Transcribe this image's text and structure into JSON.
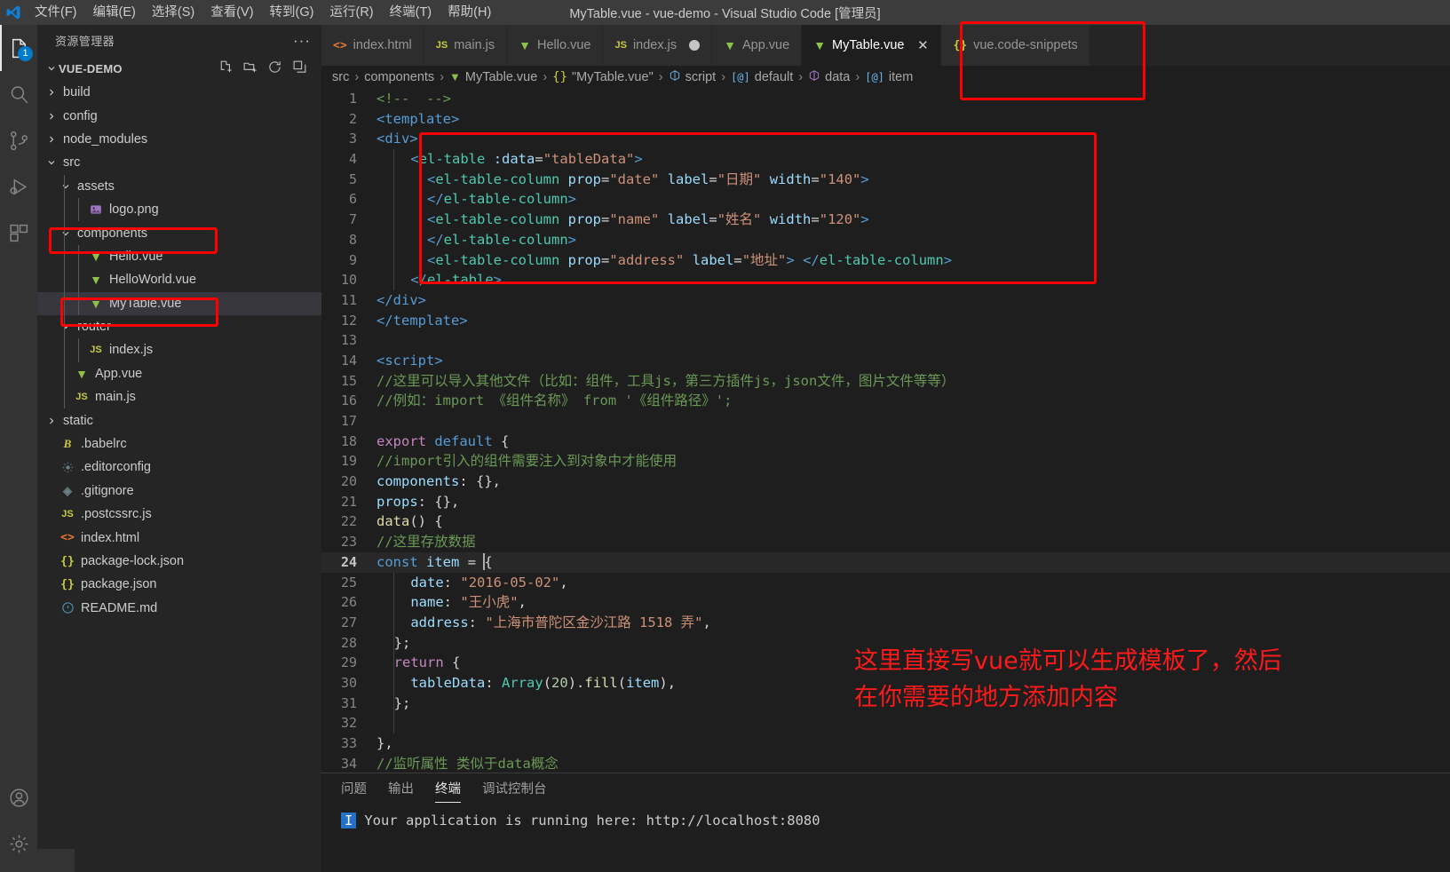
{
  "titlebar": {
    "window_title": "MyTable.vue - vue-demo - Visual Studio Code [管理员]",
    "menus": [
      {
        "label": "文件(F)"
      },
      {
        "label": "编辑(E)"
      },
      {
        "label": "选择(S)"
      },
      {
        "label": "查看(V)"
      },
      {
        "label": "转到(G)"
      },
      {
        "label": "运行(R)"
      },
      {
        "label": "终端(T)"
      },
      {
        "label": "帮助(H)"
      }
    ]
  },
  "activitybar": {
    "items": [
      {
        "name": "explorer-icon",
        "badge": "1",
        "active": true
      },
      {
        "name": "search-icon",
        "badge": "",
        "active": false
      },
      {
        "name": "source-control-icon",
        "badge": "",
        "active": false
      },
      {
        "name": "run-and-debug-icon",
        "badge": "",
        "active": false
      },
      {
        "name": "extensions-icon",
        "badge": "",
        "active": false
      }
    ],
    "bottom": [
      {
        "name": "accounts-icon"
      },
      {
        "name": "settings-gear-icon"
      }
    ]
  },
  "sidebar": {
    "title": "资源管理器",
    "more_actions": "···",
    "root": "VUE-DEMO",
    "root_tools": [
      "new-file-icon",
      "new-folder-icon",
      "refresh-icon",
      "collapse-all-icon"
    ],
    "tree": [
      {
        "label": "build",
        "indent": 1,
        "type": "folder",
        "expanded": false
      },
      {
        "label": "config",
        "indent": 1,
        "type": "folder",
        "expanded": false
      },
      {
        "label": "node_modules",
        "indent": 1,
        "type": "folder",
        "expanded": false
      },
      {
        "label": "src",
        "indent": 1,
        "type": "folder",
        "expanded": true
      },
      {
        "label": "assets",
        "indent": 2,
        "type": "folder",
        "expanded": true
      },
      {
        "label": "logo.png",
        "indent": 3,
        "type": "image"
      },
      {
        "label": "components",
        "indent": 2,
        "type": "folder",
        "expanded": true,
        "highlight": true
      },
      {
        "label": "Hello.vue",
        "indent": 3,
        "type": "vue"
      },
      {
        "label": "HelloWorld.vue",
        "indent": 3,
        "type": "vue"
      },
      {
        "label": "MyTable.vue",
        "indent": 3,
        "type": "vue",
        "selected": true,
        "highlight": true
      },
      {
        "label": "router",
        "indent": 2,
        "type": "folder",
        "expanded": true
      },
      {
        "label": "index.js",
        "indent": 3,
        "type": "js"
      },
      {
        "label": "App.vue",
        "indent": 2,
        "type": "vue"
      },
      {
        "label": "main.js",
        "indent": 2,
        "type": "js"
      },
      {
        "label": "static",
        "indent": 1,
        "type": "folder",
        "expanded": false
      },
      {
        "label": ".babelrc",
        "indent": 1,
        "type": "babel"
      },
      {
        "label": ".editorconfig",
        "indent": 1,
        "type": "config"
      },
      {
        "label": ".gitignore",
        "indent": 1,
        "type": "git"
      },
      {
        "label": ".postcssrc.js",
        "indent": 1,
        "type": "js"
      },
      {
        "label": "index.html",
        "indent": 1,
        "type": "html"
      },
      {
        "label": "package-lock.json",
        "indent": 1,
        "type": "json"
      },
      {
        "label": "package.json",
        "indent": 1,
        "type": "json"
      },
      {
        "label": "README.md",
        "indent": 1,
        "type": "md"
      }
    ]
  },
  "tabs": [
    {
      "label": "index.html",
      "type": "html",
      "active": false,
      "dirty": false,
      "closable": false
    },
    {
      "label": "main.js",
      "type": "js",
      "active": false,
      "dirty": false,
      "closable": false
    },
    {
      "label": "Hello.vue",
      "type": "vue",
      "active": false,
      "dirty": false,
      "closable": false
    },
    {
      "label": "index.js",
      "type": "js",
      "active": false,
      "dirty": true,
      "closable": false
    },
    {
      "label": "App.vue",
      "type": "vue",
      "active": false,
      "dirty": false,
      "closable": false
    },
    {
      "label": "MyTable.vue",
      "type": "vue",
      "active": true,
      "dirty": false,
      "closable": true,
      "close_label": "✕"
    },
    {
      "label": "vue.code-snippets",
      "type": "json",
      "active": false,
      "dirty": false,
      "closable": false
    }
  ],
  "breadcrumbs": [
    {
      "label": "src",
      "icon": ""
    },
    {
      "label": "components",
      "icon": ""
    },
    {
      "label": "MyTable.vue",
      "icon": "vue"
    },
    {
      "label": "\"MyTable.vue\"",
      "icon": "json"
    },
    {
      "label": "script",
      "icon": "symbol-object"
    },
    {
      "label": "default",
      "icon": "symbol-property"
    },
    {
      "label": "data",
      "icon": "symbol-method"
    },
    {
      "label": "item",
      "icon": "symbol-property"
    }
  ],
  "breadcrumb_separator": "›",
  "code": {
    "current_line": 24,
    "lines": [
      {
        "n": 1,
        "html": "<span class=\"t-cmt\">&lt;!--  --&gt;</span>"
      },
      {
        "n": 2,
        "html": "<span class=\"t-tag\">&lt;</span><span class=\"t-tag\">template</span><span class=\"t-tag\">&gt;</span>"
      },
      {
        "n": 3,
        "html": "<span class=\"t-tag\">&lt;</span><span class=\"t-tag\">div</span><span class=\"t-tag\">&gt;</span>"
      },
      {
        "n": 4,
        "html": "  <span class=\"guide\"></span>  <span class=\"t-tag\">&lt;</span><span class=\"t-tagname\">el-table</span> <span class=\"t-attr\">:data</span><span class=\"t-punc\">=</span><span class=\"t-str\">\"tableData\"</span><span class=\"t-tag\">&gt;</span>"
      },
      {
        "n": 5,
        "html": "  <span class=\"guide\"></span>    <span class=\"t-tag\">&lt;</span><span class=\"t-tagname\">el-table-column</span> <span class=\"t-attr\">prop</span><span class=\"t-punc\">=</span><span class=\"t-str\">\"date\"</span> <span class=\"t-attr\">label</span><span class=\"t-punc\">=</span><span class=\"t-str\">\"日期\"</span> <span class=\"t-attr\">width</span><span class=\"t-punc\">=</span><span class=\"t-str\">\"140\"</span><span class=\"t-tag\">&gt;</span>"
      },
      {
        "n": 6,
        "html": "  <span class=\"guide\"></span>    <span class=\"t-tag\">&lt;/</span><span class=\"t-tagname\">el-table-column</span><span class=\"t-tag\">&gt;</span>"
      },
      {
        "n": 7,
        "html": "  <span class=\"guide\"></span>    <span class=\"t-tag\">&lt;</span><span class=\"t-tagname\">el-table-column</span> <span class=\"t-attr\">prop</span><span class=\"t-punc\">=</span><span class=\"t-str\">\"name\"</span> <span class=\"t-attr\">label</span><span class=\"t-punc\">=</span><span class=\"t-str\">\"姓名\"</span> <span class=\"t-attr\">width</span><span class=\"t-punc\">=</span><span class=\"t-str\">\"120\"</span><span class=\"t-tag\">&gt;</span>"
      },
      {
        "n": 8,
        "html": "  <span class=\"guide\"></span>    <span class=\"t-tag\">&lt;/</span><span class=\"t-tagname\">el-table-column</span><span class=\"t-tag\">&gt;</span>"
      },
      {
        "n": 9,
        "html": "  <span class=\"guide\"></span>    <span class=\"t-tag\">&lt;</span><span class=\"t-tagname\">el-table-column</span> <span class=\"t-attr\">prop</span><span class=\"t-punc\">=</span><span class=\"t-str\">\"address\"</span> <span class=\"t-attr\">label</span><span class=\"t-punc\">=</span><span class=\"t-str\">\"地址\"</span><span class=\"t-tag\">&gt;</span> <span class=\"t-tag\">&lt;/</span><span class=\"t-tagname\">el-table-column</span><span class=\"t-tag\">&gt;</span>"
      },
      {
        "n": 10,
        "html": "  <span class=\"guide\"></span>  <span class=\"t-tag\">&lt;/</span><span class=\"t-tagname\">el-table</span><span class=\"t-tag\">&gt;</span>"
      },
      {
        "n": 11,
        "html": "<span class=\"t-tag\">&lt;/</span><span class=\"t-tag\">div</span><span class=\"t-tag\">&gt;</span>"
      },
      {
        "n": 12,
        "html": "<span class=\"t-tag\">&lt;/</span><span class=\"t-tag\">template</span><span class=\"t-tag\">&gt;</span>"
      },
      {
        "n": 13,
        "html": ""
      },
      {
        "n": 14,
        "html": "<span class=\"t-tag\">&lt;</span><span class=\"t-tag\">script</span><span class=\"t-tag\">&gt;</span>"
      },
      {
        "n": 15,
        "html": "<span class=\"t-cmt\">//这里可以导入其他文件（比如：组件，工具js，第三方插件js，json文件，图片文件等等）</span>"
      },
      {
        "n": 16,
        "html": "<span class=\"t-cmt\">//例如：import 《组件名称》 from '《组件路径》';</span>"
      },
      {
        "n": 17,
        "html": ""
      },
      {
        "n": 18,
        "html": "<span class=\"t-kw\">export</span> <span class=\"t-kw2\">default</span> <span class=\"t-punc\">{</span>"
      },
      {
        "n": 19,
        "html": "<span class=\"t-cmt\">//import引入的组件需要注入到对象中才能使用</span>"
      },
      {
        "n": 20,
        "html": "<span class=\"t-prop\">components</span><span class=\"t-punc\">: {},</span>"
      },
      {
        "n": 21,
        "html": "<span class=\"t-prop\">props</span><span class=\"t-punc\">: {},</span>"
      },
      {
        "n": 22,
        "html": "<span class=\"t-fn\">data</span><span class=\"t-punc\">() {</span>"
      },
      {
        "n": 23,
        "html": "<span class=\"t-cmt\">//这里存放数据</span>"
      },
      {
        "n": 24,
        "html": "<span class=\"t-kw2\">const</span> <span class=\"t-var\">item</span> <span class=\"t-punc\">=</span> <span class=\"cursor\"></span><span class=\"t-punc\">{</span>"
      },
      {
        "n": 25,
        "html": "  <span class=\"guide\"></span>  <span class=\"t-prop\">date</span><span class=\"t-punc\">:</span> <span class=\"t-str\">\"2016-05-02\"</span><span class=\"t-punc\">,</span>"
      },
      {
        "n": 26,
        "html": "  <span class=\"guide\"></span>  <span class=\"t-prop\">name</span><span class=\"t-punc\">:</span> <span class=\"t-str\">\"王小虎\"</span><span class=\"t-punc\">,</span>"
      },
      {
        "n": 27,
        "html": "  <span class=\"guide\"></span>  <span class=\"t-prop\">address</span><span class=\"t-punc\">:</span> <span class=\"t-str\">\"上海市普陀区金沙江路 1518 弄\"</span><span class=\"t-punc\">,</span>"
      },
      {
        "n": 28,
        "html": "  <span class=\"guide\"></span><span class=\"t-punc\">};</span>"
      },
      {
        "n": 29,
        "html": "  <span class=\"guide\"></span><span class=\"t-kw\">return</span> <span class=\"t-punc\">{</span>"
      },
      {
        "n": 30,
        "html": "  <span class=\"guide\"></span>  <span class=\"t-prop\">tableData</span><span class=\"t-punc\">:</span> <span class=\"t-cls\">Array</span><span class=\"t-punc\">(</span><span class=\"t-num\">20</span><span class=\"t-punc\">).</span><span class=\"t-fn\">fill</span><span class=\"t-punc\">(</span><span class=\"t-var\">item</span><span class=\"t-punc\">),</span>"
      },
      {
        "n": 31,
        "html": "  <span class=\"guide\"></span><span class=\"t-punc\">};</span>"
      },
      {
        "n": 32,
        "html": "  <span class=\"guide\"></span>"
      },
      {
        "n": 33,
        "html": "<span class=\"t-punc\">},</span>"
      },
      {
        "n": 34,
        "html": "<span class=\"t-cmt\">//监听属性 类似于data概念</span>"
      }
    ]
  },
  "annotations": {
    "color": "#ff0000",
    "text_line1": "这里直接写vue就可以生成模板了，然后",
    "text_line2": "在你需要的地方添加内容"
  },
  "panel": {
    "tabs": [
      {
        "label": "问题",
        "active": false
      },
      {
        "label": "输出",
        "active": false
      },
      {
        "label": "终端",
        "active": true
      },
      {
        "label": "调试控制台",
        "active": false
      }
    ],
    "terminal": {
      "badge": "I",
      "line": "Your application is running here: http://localhost:8080"
    }
  }
}
